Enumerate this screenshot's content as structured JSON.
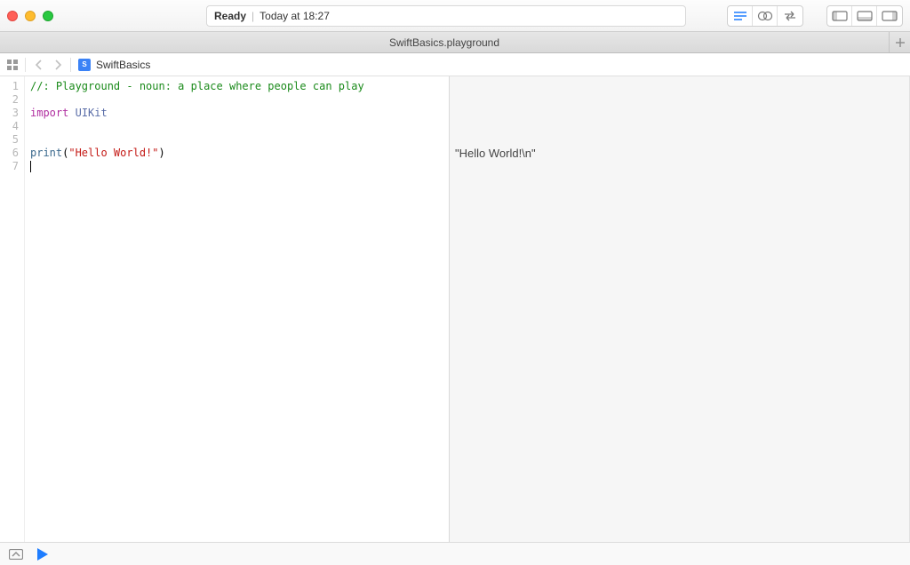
{
  "window": {
    "status_label": "Ready",
    "status_time": "Today at 18:27"
  },
  "tabs": {
    "active": "SwiftBasics.playground"
  },
  "breadcrumb": {
    "file": "SwiftBasics"
  },
  "code": {
    "lines": [
      {
        "num": "1",
        "tokens": [
          {
            "t": "//: Playground - noun: a place where people can play",
            "c": "c-comment"
          }
        ]
      },
      {
        "num": "2",
        "tokens": []
      },
      {
        "num": "3",
        "tokens": [
          {
            "t": "import",
            "c": "c-keyword"
          },
          {
            "t": " "
          },
          {
            "t": "UIKit",
            "c": "c-ident"
          }
        ]
      },
      {
        "num": "4",
        "tokens": []
      },
      {
        "num": "5",
        "tokens": []
      },
      {
        "num": "6",
        "tokens": [
          {
            "t": "print",
            "c": "c-func"
          },
          {
            "t": "("
          },
          {
            "t": "\"Hello World!\"",
            "c": "c-string"
          },
          {
            "t": ")"
          }
        ]
      },
      {
        "num": "7",
        "tokens": [],
        "cursor": true
      }
    ]
  },
  "results": {
    "lines": {
      "1": "",
      "2": "",
      "3": "",
      "4": "",
      "5": "",
      "6": "\"Hello World!\\n\"",
      "7": ""
    }
  },
  "icons": {
    "grid": "grid-icon",
    "back": "chevron-left-icon",
    "forward": "chevron-right-icon",
    "file": "swift-file-icon",
    "lines": "lines-icon",
    "circles": "venn-icon",
    "arrows": "bidir-arrow-icon",
    "panel_left": "panel-left-icon",
    "panel_bottom": "panel-bottom-icon",
    "panel_right": "panel-right-icon",
    "add_tab": "plus-icon",
    "debug_panel": "debug-panel-icon",
    "play": "play-icon"
  },
  "colors": {
    "accent": "#1e7dff",
    "comment": "#1a8a1a",
    "keyword": "#b02fa0",
    "string": "#c41a16"
  }
}
